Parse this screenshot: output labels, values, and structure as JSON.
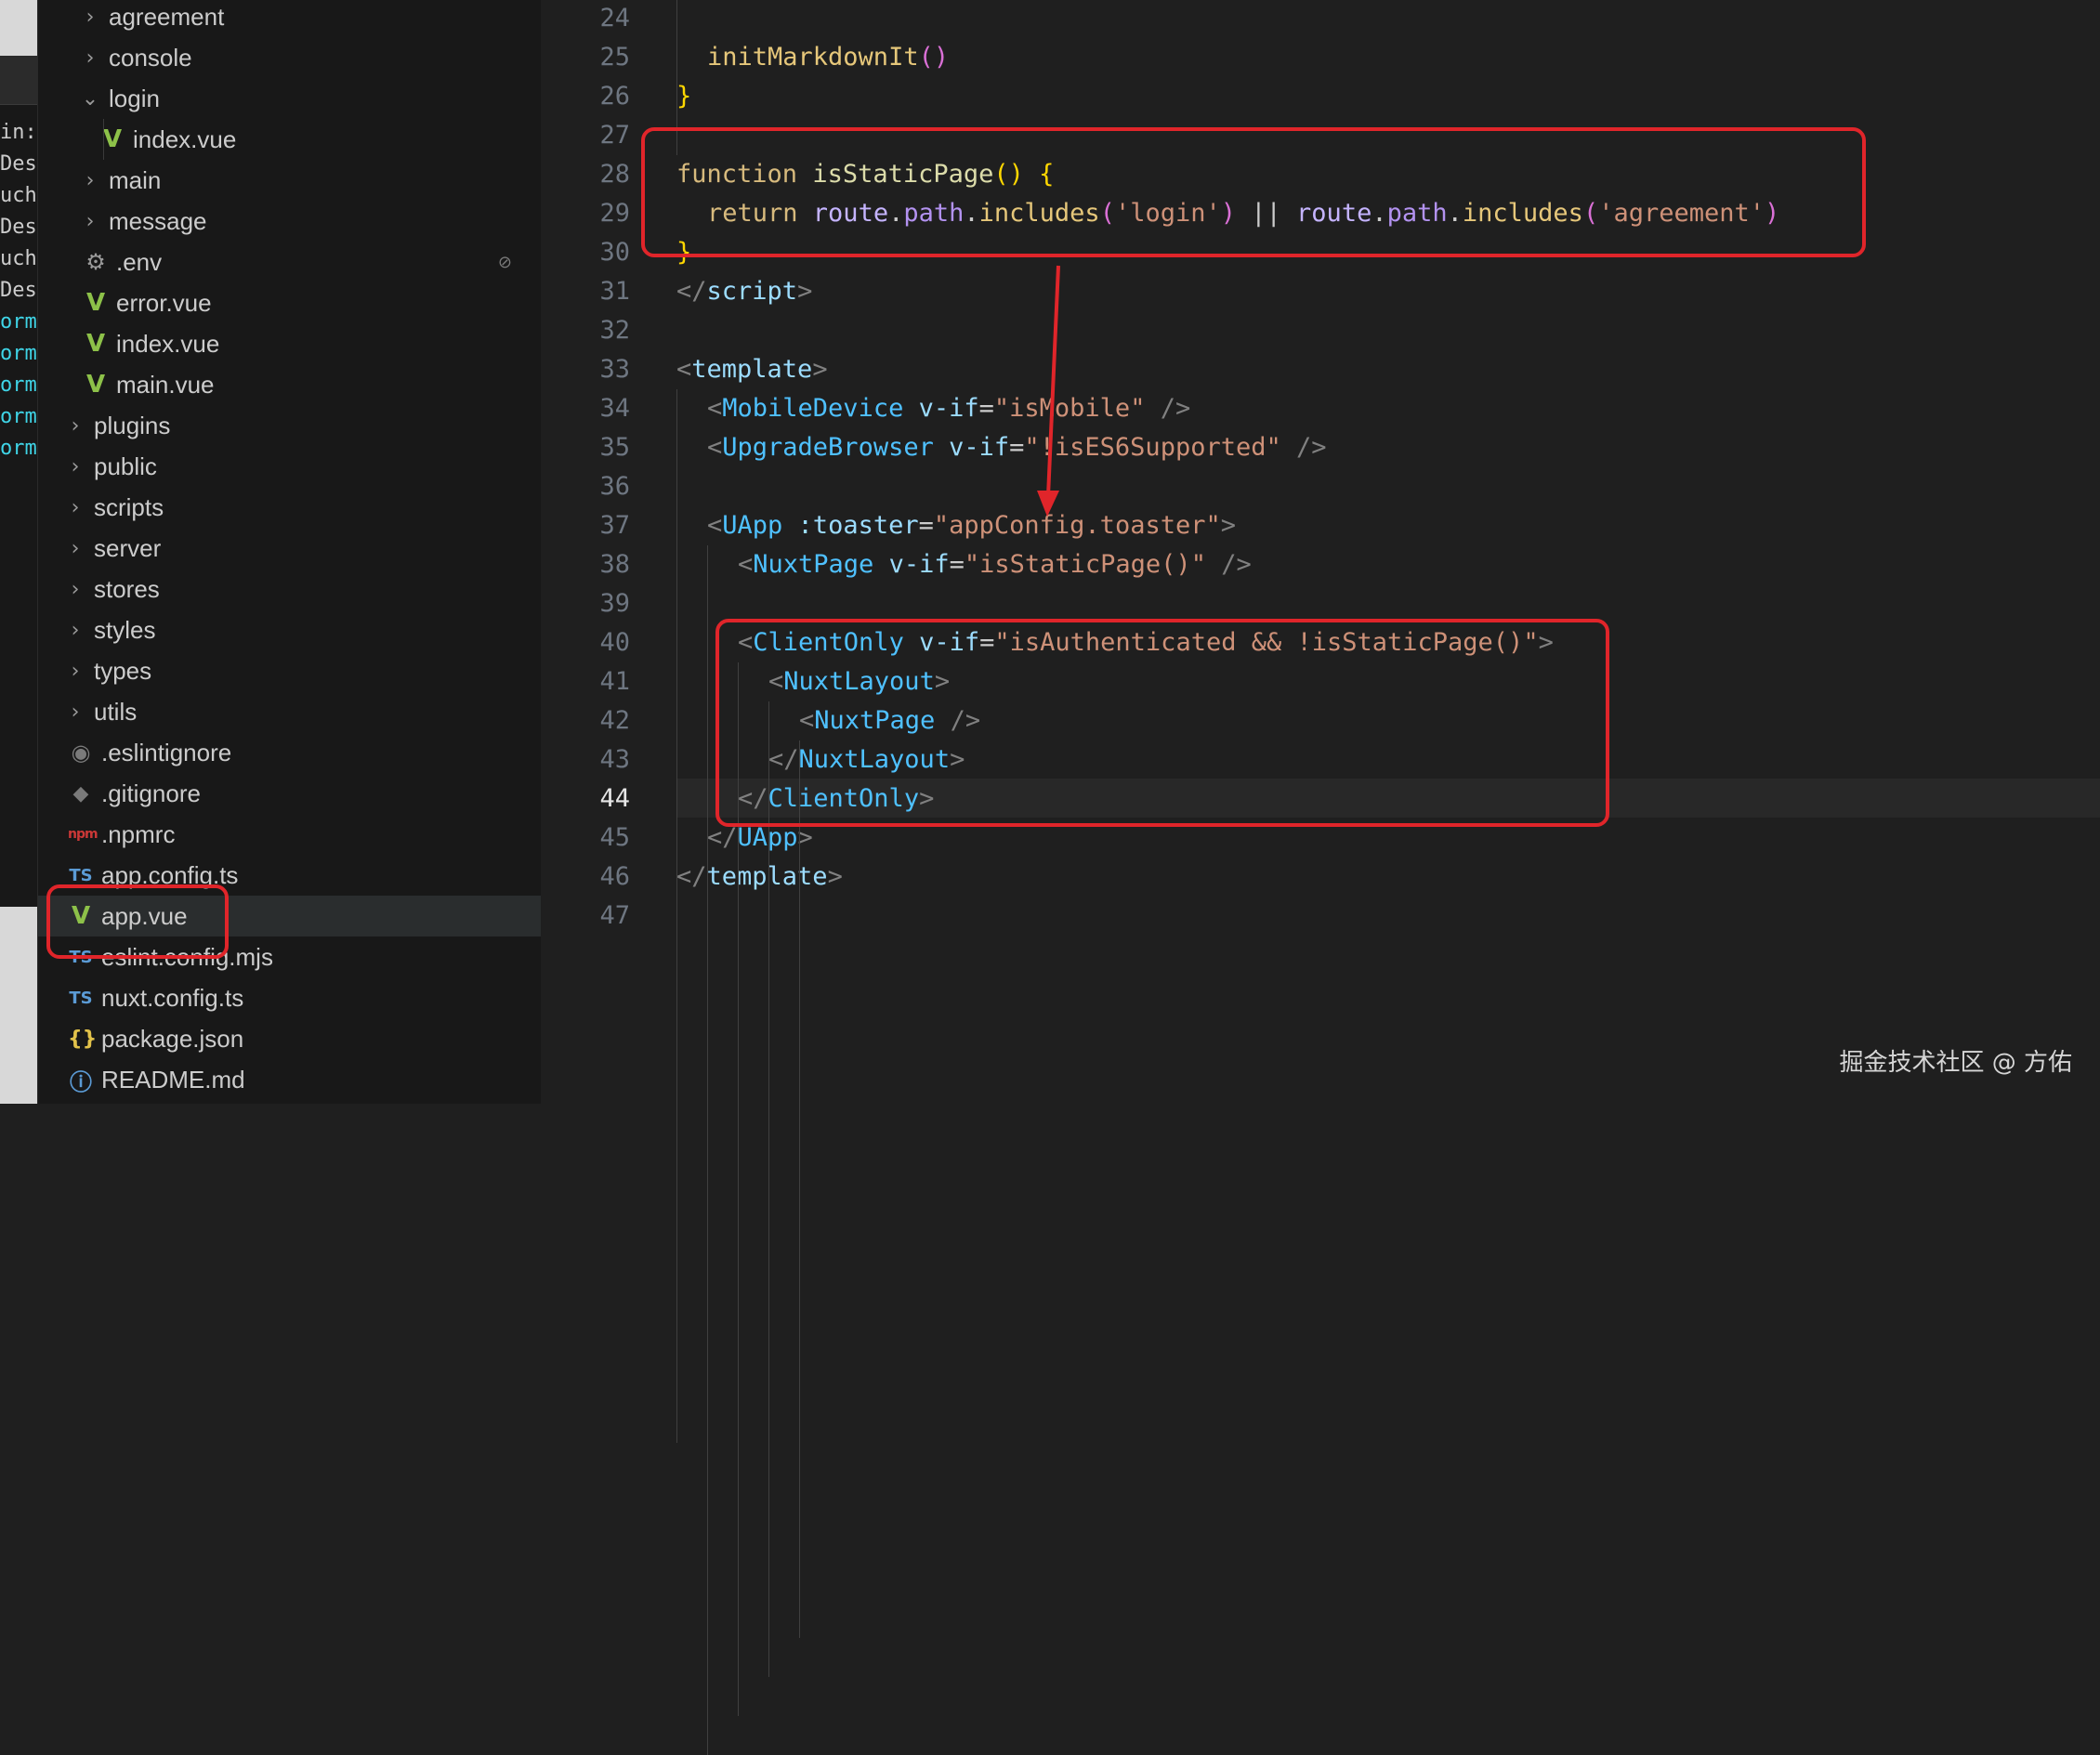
{
  "terminal": {
    "lines": [
      {
        "text": "in:",
        "style": "plain"
      },
      {
        "text": "Des",
        "style": "plain"
      },
      {
        "text": "uch",
        "style": "plain"
      },
      {
        "text": "Des",
        "style": "plain"
      },
      {
        "text": "uch",
        "style": "plain"
      },
      {
        "text": "Des",
        "style": "plain"
      },
      {
        "text": "orm",
        "style": "cyan"
      },
      {
        "text": "orm",
        "style": "cyan"
      },
      {
        "text": "orm",
        "style": "cyan"
      },
      {
        "text": "orm",
        "style": "cyan"
      },
      {
        "text": "orm",
        "style": "cyan"
      }
    ]
  },
  "explorer": {
    "items": [
      {
        "label": "agreement",
        "type": "folder",
        "expanded": false,
        "depth": 2
      },
      {
        "label": "console",
        "type": "folder",
        "expanded": false,
        "depth": 2
      },
      {
        "label": "login",
        "type": "folder",
        "expanded": true,
        "depth": 2
      },
      {
        "label": "index.vue",
        "type": "vue",
        "depth": 3
      },
      {
        "label": "main",
        "type": "folder",
        "expanded": false,
        "depth": 2
      },
      {
        "label": "message",
        "type": "folder",
        "expanded": false,
        "depth": 2
      },
      {
        "label": ".env",
        "type": "gear",
        "depth": 2,
        "badge": "⊘"
      },
      {
        "label": "error.vue",
        "type": "vue",
        "depth": 2
      },
      {
        "label": "index.vue",
        "type": "vue",
        "depth": 2
      },
      {
        "label": "main.vue",
        "type": "vue",
        "depth": 2
      },
      {
        "label": "plugins",
        "type": "folder",
        "expanded": false,
        "depth": 1
      },
      {
        "label": "public",
        "type": "folder",
        "expanded": false,
        "depth": 1
      },
      {
        "label": "scripts",
        "type": "folder",
        "expanded": false,
        "depth": 1
      },
      {
        "label": "server",
        "type": "folder",
        "expanded": false,
        "depth": 1
      },
      {
        "label": "stores",
        "type": "folder",
        "expanded": false,
        "depth": 1
      },
      {
        "label": "styles",
        "type": "folder",
        "expanded": false,
        "depth": 1
      },
      {
        "label": "types",
        "type": "folder",
        "expanded": false,
        "depth": 1
      },
      {
        "label": "utils",
        "type": "folder",
        "expanded": false,
        "depth": 1
      },
      {
        "label": ".eslintignore",
        "type": "circle",
        "depth": 1
      },
      {
        "label": ".gitignore",
        "type": "diamond",
        "depth": 1
      },
      {
        "label": ".npmrc",
        "type": "npm",
        "depth": 1
      },
      {
        "label": "app.config.ts",
        "type": "ts",
        "depth": 1
      },
      {
        "label": "app.vue",
        "type": "vue",
        "depth": 1,
        "selected": true
      },
      {
        "label": "eslint.config.mjs",
        "type": "ts",
        "depth": 1
      },
      {
        "label": "nuxt.config.ts",
        "type": "ts",
        "depth": 1
      },
      {
        "label": "package.json",
        "type": "json",
        "depth": 1
      },
      {
        "label": "README.md",
        "type": "info",
        "depth": 1
      }
    ],
    "icon_glyphs": {
      "vue": "V",
      "ts": "TS",
      "gear": "⚙",
      "circle": "◉",
      "diamond": "◆",
      "npm": "npm",
      "json": "{}",
      "info": "ⓘ",
      "chevron_collapsed": "›",
      "chevron_expanded": "⌄"
    }
  },
  "editor": {
    "current_line": 44,
    "lines": [
      {
        "n": 24,
        "indent": 0,
        "tokens": []
      },
      {
        "n": 25,
        "indent": 1,
        "tokens": [
          [
            "initMarkdownIt",
            "fn2"
          ],
          [
            "()",
            "paren"
          ]
        ]
      },
      {
        "n": 26,
        "indent": 0,
        "tokens": [
          [
            "}",
            "brace"
          ]
        ]
      },
      {
        "n": 27,
        "indent": 0,
        "tokens": []
      },
      {
        "n": 28,
        "indent": 0,
        "tokens": [
          [
            "function ",
            "kwfn"
          ],
          [
            "isStaticPage",
            "fn"
          ],
          [
            "() ",
            "brace"
          ],
          [
            "{",
            "brace"
          ]
        ]
      },
      {
        "n": 29,
        "indent": 1,
        "tokens": [
          [
            "return ",
            "kwfn"
          ],
          [
            "route",
            "var"
          ],
          [
            ".",
            "plain"
          ],
          [
            "path",
            "prop"
          ],
          [
            ".",
            "plain"
          ],
          [
            "includes",
            "fn2"
          ],
          [
            "(",
            "paren"
          ],
          [
            "'login'",
            "str"
          ],
          [
            ")",
            "paren"
          ],
          [
            " || ",
            "plain"
          ],
          [
            "route",
            "var"
          ],
          [
            ".",
            "plain"
          ],
          [
            "path",
            "prop"
          ],
          [
            ".",
            "plain"
          ],
          [
            "includes",
            "fn2"
          ],
          [
            "(",
            "paren"
          ],
          [
            "'agreement'",
            "str"
          ],
          [
            ")",
            "paren"
          ]
        ]
      },
      {
        "n": 30,
        "indent": 0,
        "tokens": [
          [
            "}",
            "brace"
          ]
        ]
      },
      {
        "n": 31,
        "indent": 0,
        "tokens": [
          [
            "</",
            "punc"
          ],
          [
            "script",
            "tag"
          ],
          [
            ">",
            "punc"
          ]
        ]
      },
      {
        "n": 32,
        "indent": 0,
        "tokens": []
      },
      {
        "n": 33,
        "indent": 0,
        "tokens": [
          [
            "<",
            "punc"
          ],
          [
            "template",
            "tag"
          ],
          [
            ">",
            "punc"
          ]
        ]
      },
      {
        "n": 34,
        "indent": 1,
        "tokens": [
          [
            "<",
            "punc"
          ],
          [
            "MobileDevice",
            "tagname"
          ],
          [
            " v-if",
            "attr"
          ],
          [
            "=",
            "plain"
          ],
          [
            "\"isMobile\"",
            "str"
          ],
          [
            " />",
            "punc"
          ]
        ]
      },
      {
        "n": 35,
        "indent": 1,
        "tokens": [
          [
            "<",
            "punc"
          ],
          [
            "UpgradeBrowser",
            "tagname"
          ],
          [
            " v-if",
            "attr"
          ],
          [
            "=",
            "plain"
          ],
          [
            "\"!isES6Supported\"",
            "str"
          ],
          [
            " />",
            "punc"
          ]
        ]
      },
      {
        "n": 36,
        "indent": 0,
        "tokens": []
      },
      {
        "n": 37,
        "indent": 1,
        "tokens": [
          [
            "<",
            "punc"
          ],
          [
            "UApp",
            "tagname"
          ],
          [
            " :toaster",
            "attr"
          ],
          [
            "=",
            "plain"
          ],
          [
            "\"appConfig.toaster\"",
            "str"
          ],
          [
            ">",
            "punc"
          ]
        ]
      },
      {
        "n": 38,
        "indent": 2,
        "tokens": [
          [
            "<",
            "punc"
          ],
          [
            "NuxtPage",
            "tagname"
          ],
          [
            " v-if",
            "attr"
          ],
          [
            "=",
            "plain"
          ],
          [
            "\"isStaticPage()\"",
            "str"
          ],
          [
            " />",
            "punc"
          ]
        ]
      },
      {
        "n": 39,
        "indent": 0,
        "tokens": []
      },
      {
        "n": 40,
        "indent": 2,
        "tokens": [
          [
            "<",
            "punc"
          ],
          [
            "ClientOnly",
            "tagname"
          ],
          [
            " v-if",
            "attr"
          ],
          [
            "=",
            "plain"
          ],
          [
            "\"isAuthenticated && !isStaticPage()\"",
            "str"
          ],
          [
            ">",
            "punc"
          ]
        ]
      },
      {
        "n": 41,
        "indent": 3,
        "tokens": [
          [
            "<",
            "punc"
          ],
          [
            "NuxtLayout",
            "tagname"
          ],
          [
            ">",
            "punc"
          ]
        ]
      },
      {
        "n": 42,
        "indent": 4,
        "tokens": [
          [
            "<",
            "punc"
          ],
          [
            "NuxtPage",
            "tagname"
          ],
          [
            " />",
            "punc"
          ]
        ]
      },
      {
        "n": 43,
        "indent": 3,
        "tokens": [
          [
            "</",
            "punc"
          ],
          [
            "NuxtLayout",
            "tagname"
          ],
          [
            ">",
            "punc"
          ]
        ]
      },
      {
        "n": 44,
        "indent": 2,
        "tokens": [
          [
            "</",
            "punc"
          ],
          [
            "ClientOnly",
            "tagname"
          ],
          [
            ">",
            "punc"
          ]
        ]
      },
      {
        "n": 45,
        "indent": 1,
        "tokens": [
          [
            "</",
            "punc"
          ],
          [
            "UApp",
            "tagname"
          ],
          [
            ">",
            "punc"
          ]
        ]
      },
      {
        "n": 46,
        "indent": 0,
        "tokens": [
          [
            "</",
            "punc"
          ],
          [
            "template",
            "tag"
          ],
          [
            ">",
            "punc"
          ]
        ]
      },
      {
        "n": 47,
        "indent": 0,
        "tokens": []
      }
    ]
  },
  "annotation_color": "#e0252a",
  "watermark": "掘金技术社区 @ 方佑"
}
